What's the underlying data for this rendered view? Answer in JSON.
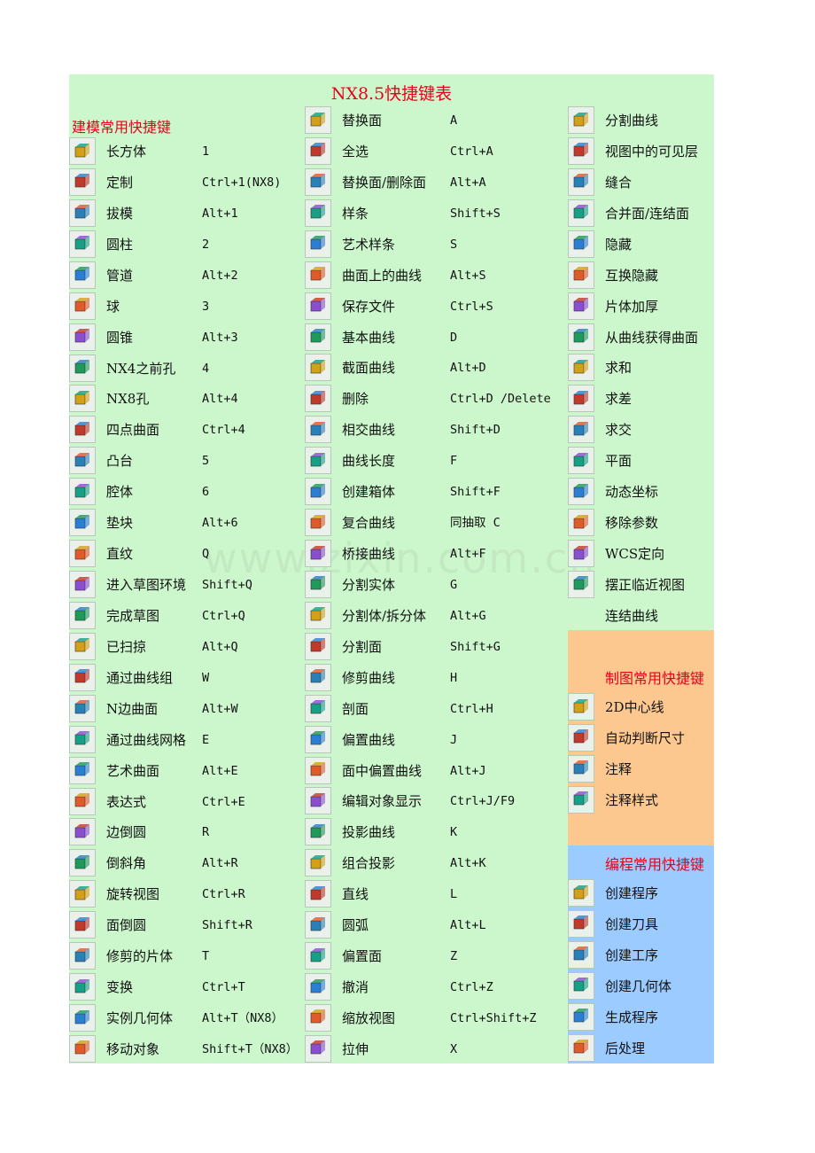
{
  "title": "NX8.5快捷键表",
  "watermark": "www.zixin.com.cn",
  "sections": {
    "modeling": "建模常用快捷键",
    "drafting": "制图常用快捷键",
    "programming": "编程常用快捷键"
  },
  "col1": [
    {
      "icon": "block-icon",
      "label": "长方体",
      "key": "1"
    },
    {
      "icon": "customize-icon",
      "label": "定制",
      "key": "Ctrl+1(NX8)"
    },
    {
      "icon": "draft-icon",
      "label": "拔模",
      "key": "Alt+1"
    },
    {
      "icon": "cylinder-icon",
      "label": "圆柱",
      "key": "2"
    },
    {
      "icon": "tube-icon",
      "label": "管道",
      "key": "Alt+2"
    },
    {
      "icon": "sphere-icon",
      "label": "球",
      "key": "3"
    },
    {
      "icon": "cone-icon",
      "label": "圆锥",
      "key": "Alt+3"
    },
    {
      "icon": "hole-icon",
      "label": "NX4之前孔",
      "key": "4"
    },
    {
      "icon": "hole-nx8-icon",
      "label": "NX8孔",
      "key": "Alt+4"
    },
    {
      "icon": "four-point-surface-icon",
      "label": "四点曲面",
      "key": "Ctrl+4"
    },
    {
      "icon": "boss-icon",
      "label": "凸台",
      "key": "5"
    },
    {
      "icon": "pocket-icon",
      "label": "腔体",
      "key": "6"
    },
    {
      "icon": "pad-icon",
      "label": "垫块",
      "key": "Alt+6"
    },
    {
      "icon": "ruled-icon",
      "label": "直纹",
      "key": "Q"
    },
    {
      "icon": "sketch-task-icon",
      "label": "进入草图环境",
      "key": "Shift+Q"
    },
    {
      "icon": "finish-sketch-flag-icon",
      "label": "完成草图",
      "key": "Ctrl+Q"
    },
    {
      "icon": "swept-icon",
      "label": "已扫掠",
      "key": "Alt+Q"
    },
    {
      "icon": "through-curves-icon",
      "label": "通过曲线组",
      "key": "W"
    },
    {
      "icon": "n-sided-surface-icon",
      "label": "N边曲面",
      "key": "Alt+W"
    },
    {
      "icon": "through-curve-mesh-icon",
      "label": "通过曲线网格",
      "key": "E"
    },
    {
      "icon": "studio-surface-icon",
      "label": "艺术曲面",
      "key": "Alt+E"
    },
    {
      "icon": "expression-icon",
      "label": "表达式",
      "key": "Ctrl+E"
    },
    {
      "icon": "edge-blend-icon",
      "label": "边倒圆",
      "key": "R"
    },
    {
      "icon": "chamfer-icon",
      "label": "倒斜角",
      "key": "Alt+R"
    },
    {
      "icon": "rotate-view-icon",
      "label": "旋转视图",
      "key": "Ctrl+R"
    },
    {
      "icon": "face-blend-icon",
      "label": "面倒圆",
      "key": "Shift+R"
    },
    {
      "icon": "trimmed-sheet-icon",
      "label": "修剪的片体",
      "key": "T"
    },
    {
      "icon": "transform-icon",
      "label": "变换",
      "key": "Ctrl+T"
    },
    {
      "icon": "instance-geometry-icon",
      "label": "实例几何体",
      "key": "Alt+T（NX8）"
    },
    {
      "icon": "move-object-icon",
      "label": "移动对象",
      "key": "Shift+T（NX8）"
    }
  ],
  "col2": [
    {
      "icon": "replace-face-icon",
      "label": "替换面",
      "key": "A"
    },
    {
      "icon": "select-all-icon",
      "label": "全选",
      "key": "Ctrl+A"
    },
    {
      "icon": "replace-delete-face-icon",
      "label": "替换面/删除面",
      "key": "Alt+A"
    },
    {
      "icon": "spline-icon",
      "label": "样条",
      "key": "Shift+S"
    },
    {
      "icon": "studio-spline-icon",
      "label": "艺术样条",
      "key": "S"
    },
    {
      "icon": "curve-on-surface-icon",
      "label": "曲面上的曲线",
      "key": "Alt+S"
    },
    {
      "icon": "save-icon",
      "label": "保存文件",
      "key": "Ctrl+S"
    },
    {
      "icon": "basic-curves-icon",
      "label": "基本曲线",
      "key": "D"
    },
    {
      "icon": "section-curve-icon",
      "label": "截面曲线",
      "key": "Alt+D"
    },
    {
      "icon": "delete-icon",
      "label": "删除",
      "key": "Ctrl+D /Delete"
    },
    {
      "icon": "intersection-curve-icon",
      "label": "相交曲线",
      "key": "Shift+D"
    },
    {
      "icon": "curve-length-icon",
      "label": "曲线长度",
      "key": "F"
    },
    {
      "icon": "bounding-body-icon",
      "label": "创建箱体",
      "key": "Shift+F"
    },
    {
      "icon": "composite-curve-icon",
      "label": "复合曲线",
      "key": "同抽取 C"
    },
    {
      "icon": "bridge-curve-icon",
      "label": "桥接曲线",
      "key": "Alt+F"
    },
    {
      "icon": "split-body-icon",
      "label": "分割实体",
      "key": "G"
    },
    {
      "icon": "divide-body-icon",
      "label": "分割体/拆分体",
      "key": "Alt+G"
    },
    {
      "icon": "divide-face-icon",
      "label": "分割面",
      "key": "Shift+G"
    },
    {
      "icon": "trim-curve-icon",
      "label": "修剪曲线",
      "key": "H"
    },
    {
      "icon": "section-hatch-icon",
      "label": "剖面",
      "key": "Ctrl+H"
    },
    {
      "icon": "offset-curve-icon",
      "label": "偏置曲线",
      "key": "J"
    },
    {
      "icon": "offset-in-face-icon",
      "label": "面中偏置曲线",
      "key": "Alt+J"
    },
    {
      "icon": "edit-display-icon",
      "label": "编辑对象显示",
      "key": "Ctrl+J/F9"
    },
    {
      "icon": "project-curve-icon",
      "label": "投影曲线",
      "key": "K"
    },
    {
      "icon": "combined-projection-icon",
      "label": "组合投影",
      "key": "Alt+K"
    },
    {
      "icon": "line-icon",
      "label": "直线",
      "key": "L"
    },
    {
      "icon": "arc-icon",
      "label": "圆弧",
      "key": "Alt+L"
    },
    {
      "icon": "offset-face-icon",
      "label": "偏置面",
      "key": "Z"
    },
    {
      "icon": "undo-icon",
      "label": "撤消",
      "key": "Ctrl+Z"
    },
    {
      "icon": "zoom-icon",
      "label": "缩放视图",
      "key": "Ctrl+Shift+Z"
    },
    {
      "icon": "extrude-icon",
      "label": "拉伸",
      "key": "X"
    }
  ],
  "col3": [
    {
      "icon": "divide-curve-icon",
      "label": "分割曲线"
    },
    {
      "icon": "visible-layers-icon",
      "label": "视图中的可见层"
    },
    {
      "icon": "sew-icon",
      "label": "缝合"
    },
    {
      "icon": "unite-faces-icon",
      "label": "合并面/连结面"
    },
    {
      "icon": "hide-icon",
      "label": "隐藏"
    },
    {
      "icon": "invert-hidden-icon",
      "label": "互换隐藏"
    },
    {
      "icon": "thicken-icon",
      "label": "片体加厚"
    },
    {
      "icon": "surface-from-curves-icon",
      "label": "从曲线获得曲面"
    },
    {
      "icon": "unite-icon",
      "label": "求和"
    },
    {
      "icon": "subtract-icon",
      "label": "求差"
    },
    {
      "icon": "intersect-icon",
      "label": "求交"
    },
    {
      "icon": "plane-icon",
      "label": "平面"
    },
    {
      "icon": "dynamic-csys-icon",
      "label": "动态坐标"
    },
    {
      "icon": "remove-parameters-icon",
      "label": "移除参数"
    },
    {
      "icon": "wcs-orient-icon",
      "label": "WCS定向"
    },
    {
      "icon": "orient-view-icon",
      "label": "摆正临近视图"
    },
    {
      "icon": "",
      "label": "连结曲线"
    }
  ],
  "drafting": [
    {
      "icon": "2d-centerline-icon",
      "label": "2D中心线"
    },
    {
      "icon": "rapid-dimension-icon",
      "label": "自动判断尺寸"
    },
    {
      "icon": "note-icon",
      "label": "注释"
    },
    {
      "icon": "annotation-style-icon",
      "label": "注释样式"
    }
  ],
  "programming": [
    {
      "icon": "create-program-icon",
      "label": "创建程序"
    },
    {
      "icon": "create-tool-icon",
      "label": "创建刀具"
    },
    {
      "icon": "create-operation-icon",
      "label": "创建工序"
    },
    {
      "icon": "create-geometry-icon",
      "label": "创建几何体"
    },
    {
      "icon": "generate-program-icon",
      "label": "生成程序"
    },
    {
      "icon": "postprocess-icon",
      "label": "后处理"
    }
  ],
  "colors": {
    "sheet": "#ccf7cc",
    "title": "#e8001c",
    "drafting_band": "#fdc890",
    "programming_band": "#9ccbff"
  }
}
